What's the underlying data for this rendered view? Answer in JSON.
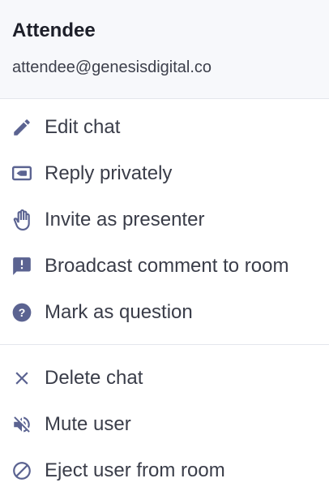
{
  "header": {
    "name": "Attendee",
    "email": "attendee@genesisdigital.co"
  },
  "menu": {
    "primary": [
      {
        "label": "Edit chat",
        "icon": "pencil-icon"
      },
      {
        "label": "Reply privately",
        "icon": "reply-private-icon"
      },
      {
        "label": "Invite as presenter",
        "icon": "hand-icon"
      },
      {
        "label": "Broadcast comment to room",
        "icon": "announcement-icon"
      },
      {
        "label": "Mark as question",
        "icon": "question-icon"
      }
    ],
    "secondary": [
      {
        "label": "Delete chat",
        "icon": "close-icon"
      },
      {
        "label": "Mute user",
        "icon": "mute-icon"
      },
      {
        "label": "Eject user from room",
        "icon": "block-icon"
      }
    ]
  },
  "colors": {
    "icon": "#5b6391",
    "text": "#3a3d49",
    "header_bg": "#f7f8fb",
    "divider": "#e4e6ec"
  }
}
